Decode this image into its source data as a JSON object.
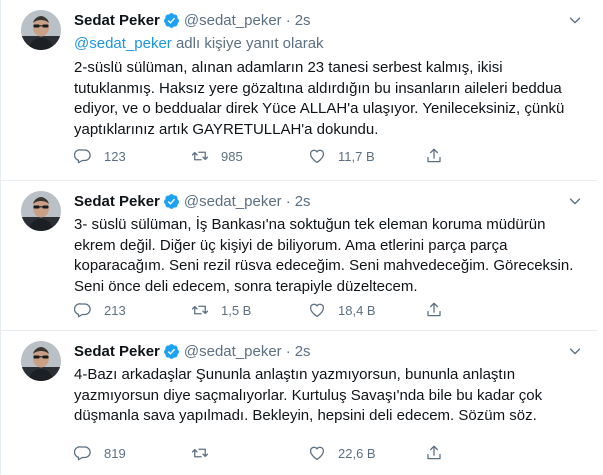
{
  "colors": {
    "accent": "#1da1f2",
    "link": "#1b95e0",
    "muted": "#5b7083",
    "text": "#0f1419",
    "divider": "#e6ecf0"
  },
  "tweets": [
    {
      "name": "Sedat Peker",
      "handle": "@sedat_peker",
      "dot": "·",
      "time": "2s",
      "reply_link": "@sedat_peker",
      "reply_suffix": " adlı kişiye yanıt olarak",
      "text": "2-süslü sülüman, alınan adamların 23 tanesi serbest kalmış, ikisi tutuklanmış. Haksız yere gözaltına aldırdığın bu insanların aileleri beddua ediyor, ve o beddualar direk Yüce ALLAH'a ulaşıyor. Yenileceksiniz, çünkü yaptıklarınız artık GAYRETULLAH'a dokundu.",
      "replies": "123",
      "retweets": "985",
      "likes": "11,7 B"
    },
    {
      "name": "Sedat Peker",
      "handle": "@sedat_peker",
      "dot": "·",
      "time": "2s",
      "text": "3- süslü sülüman, İş Bankası'na soktuğun tek eleman koruma müdürün ekrem değil. Diğer üç kişiyi de biliyorum. Ama etlerini parça parça koparacağım. Seni rezil rüsva edeceğim. Seni mahvedeceğim. Göreceksin. Seni önce deli edecem, sonra terapiyle düzeltecem.",
      "replies": "213",
      "retweets": "1,5 B",
      "likes": "18,4 B"
    },
    {
      "name": "Sedat Peker",
      "handle": "@sedat_peker",
      "dot": "·",
      "time": "2s",
      "text": "4-Bazı arkadaşlar Şununla anlaştın yazmıyorsun, bununla anlaştın yazmıyorsun diye saçmalıyorlar. Kurtuluş Savaşı'nda bile bu kadar çok düşmanla sava yapılmadı. Bekleyin, hepsini deli edecem. Sözüm söz.",
      "replies": "819",
      "retweets": "",
      "likes": "22,6 B"
    }
  ],
  "icons": {
    "verified": "verified-badge-icon",
    "more": "more-options-icon",
    "reply": "reply-icon",
    "retweet": "retweet-icon",
    "like": "heart-icon",
    "share": "share-icon"
  }
}
